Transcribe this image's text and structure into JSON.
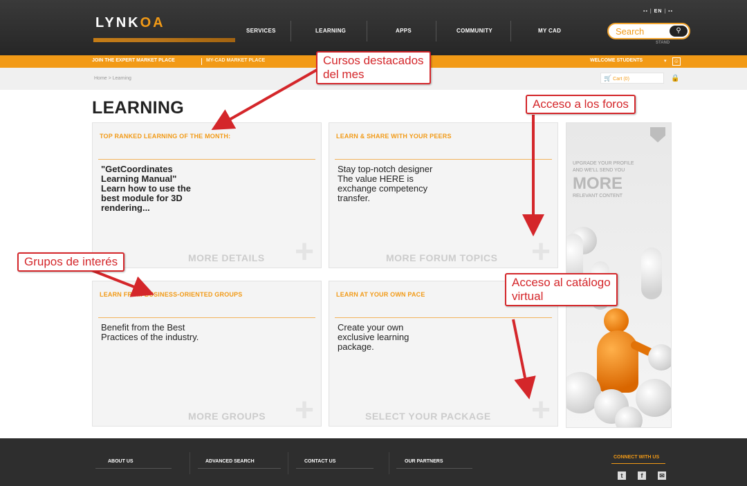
{
  "header": {
    "logo_main": "LYNK",
    "logo_accent": "OA",
    "nav": [
      "SERVICES",
      "LEARNING",
      "APPS",
      "COMMUNITY",
      "MY CAD"
    ],
    "lang_active": "EN",
    "search_placeholder": "Search",
    "search_sub": "STAND"
  },
  "orange_bar": {
    "link1": "JOIN THE EXPERT MARKET PLACE",
    "link2": "MY-CAD MARKET PLACE",
    "welcome": "WELCOME STUDENTS"
  },
  "breadcrumb": {
    "text": "Home > Learning",
    "cart": "Cart (0)"
  },
  "page_title": "LEARNING",
  "cards": [
    {
      "heading": "TOP RANKED LEARNING OF THE MONTH:",
      "lines": [
        "\"GetCoordinates",
        "Learning Manual\"",
        "Learn how to use the",
        "best module for 3D",
        "rendering..."
      ],
      "link": "MORE DETAILS"
    },
    {
      "heading": "LEARN & SHARE WITH YOUR PEERS",
      "lines": [
        "Stay top-notch designer",
        "The value HERE is",
        "exchange competency",
        "transfer."
      ],
      "link": "MORE FORUM TOPICS"
    },
    {
      "heading": "LEARN FROM BUSINESS-ORIENTED GROUPS",
      "lines": [
        "Benefit from the Best",
        "Practices of the industry."
      ],
      "link": "MORE GROUPS"
    },
    {
      "heading": "LEARN AT YOUR OWN PACE",
      "lines": [
        "Create your own",
        "exclusive learning",
        "package."
      ],
      "link": "SELECT YOUR PACKAGE"
    }
  ],
  "promo": {
    "line1": "UPGRADE YOUR PROFILE",
    "line2": "AND WE'LL SEND YOU",
    "big": "MORE",
    "line3": "RELEVANT CONTENT"
  },
  "footer": {
    "links": [
      "ABOUT US",
      "ADVANCED SEARCH",
      "CONTACT US",
      "OUR PARTNERS"
    ],
    "connect": "CONNECT WITH US",
    "social": [
      "t",
      "f",
      "✉"
    ]
  },
  "annotations": {
    "a1_line1": "Cursos destacados",
    "a1_line2": "del mes",
    "a2": "Acceso a los foros",
    "a3": "Grupos de interés",
    "a4_line1": "Acceso al catálogo",
    "a4_line2": "virtual"
  },
  "colors": {
    "accent": "#f29a16",
    "annotation": "#d4262a",
    "dark": "#2e2e2e"
  }
}
